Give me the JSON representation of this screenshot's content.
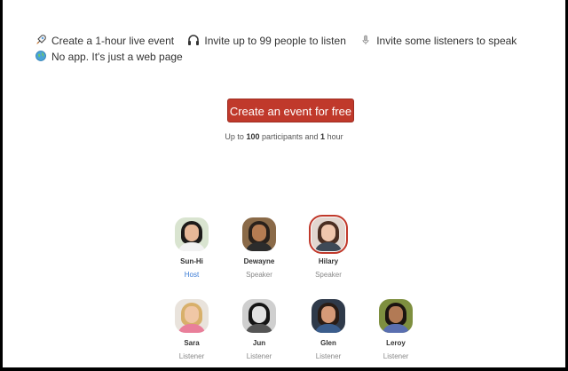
{
  "features": {
    "items": [
      {
        "icon": "rocket-icon",
        "label": "Create a 1-hour live event"
      },
      {
        "icon": "headphones-icon",
        "label": "Invite up to 99 people to listen"
      },
      {
        "icon": "microphone-icon",
        "label": "Invite some listeners to speak"
      },
      {
        "icon": "globe-icon",
        "label": "No app. It's just a web page"
      }
    ]
  },
  "cta": {
    "button_label": "Create an event for free",
    "note_prefix": "Up to",
    "note_participants": "100",
    "note_middle": "participants and",
    "note_hours": "1",
    "note_suffix": "hour"
  },
  "people": [
    {
      "name": "Sun-Hi",
      "role": "Host"
    },
    {
      "name": "Dewayne",
      "role": "Speaker"
    },
    {
      "name": "Hilary",
      "role": "Speaker"
    },
    {
      "name": "Sara",
      "role": "Listener"
    },
    {
      "name": "Jun",
      "role": "Listener"
    },
    {
      "name": "Glen",
      "role": "Listener"
    },
    {
      "name": "Leroy",
      "role": "Listener"
    }
  ],
  "colors": {
    "cta_red": "#c0392b",
    "host_blue": "#3a7bd5"
  }
}
